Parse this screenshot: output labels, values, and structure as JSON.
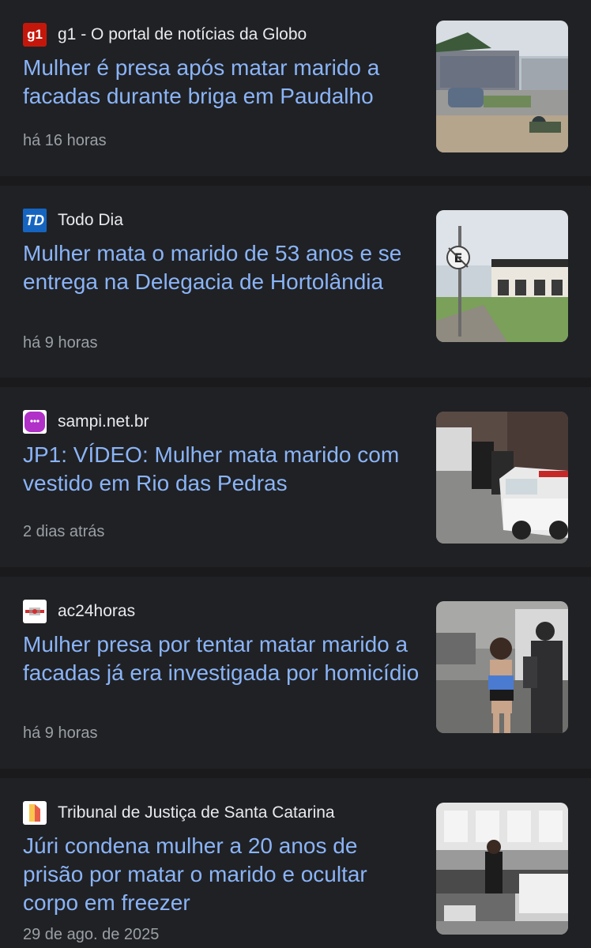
{
  "articles": [
    {
      "source": "g1 - O portal de notícias da Globo",
      "favicon_text": "g1",
      "headline": "Mulher é presa após matar marido a facadas durante briga em Paudalho",
      "time": "há 16 horas"
    },
    {
      "source": "Todo Dia",
      "favicon_text": "TD",
      "headline": "Mulher mata o marido de 53 anos e se entrega na Delegacia de Hortolândia",
      "time": "há 9 horas"
    },
    {
      "source": "sampi.net.br",
      "favicon_text": "",
      "headline": "JP1: VÍDEO: Mulher mata marido com vestido em Rio das Pedras",
      "time": "2 dias atrás"
    },
    {
      "source": "ac24horas",
      "favicon_text": "",
      "headline": "Mulher presa por tentar matar marido a facadas já era investigada por homicídio",
      "time": "há 9 horas"
    },
    {
      "source": "Tribunal de Justiça de Santa Catarina",
      "favicon_text": "",
      "headline": "Júri condena mulher a 20 anos de prisão por matar o marido e ocultar corpo em freezer",
      "time": "29 de ago. de 2025"
    }
  ],
  "colors": {
    "background": "#202124",
    "gap": "#1a1a1c",
    "headline": "#8ab4f8",
    "source": "#e8eaed",
    "timestamp": "#9aa0a6",
    "g1_red": "#c4170c",
    "todo_dia_blue": "#1565c0",
    "sampi_purple": "#b030c8"
  }
}
